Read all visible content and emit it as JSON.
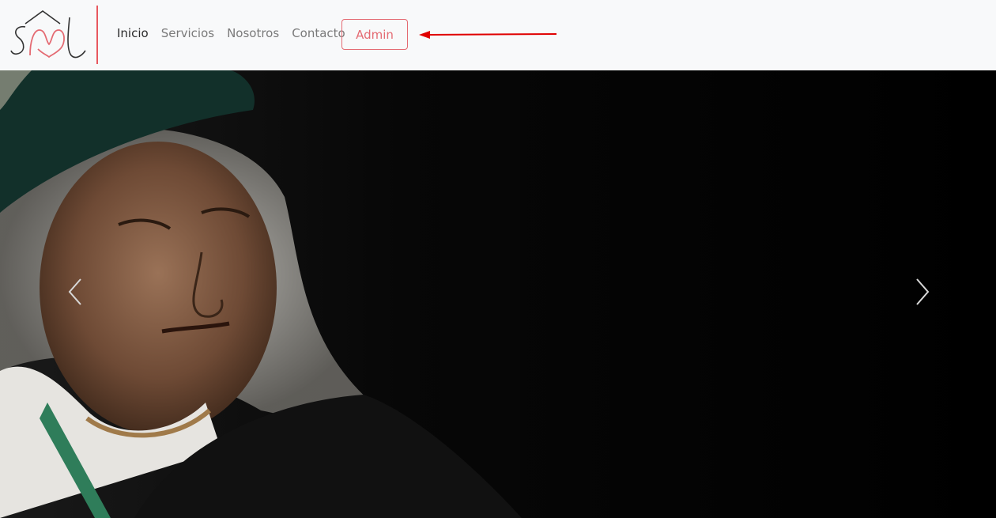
{
  "navbar": {
    "logo_alt": "SML",
    "links": [
      {
        "label": "Inicio",
        "active": true
      },
      {
        "label": "Servicios",
        "active": false
      },
      {
        "label": "Nosotros",
        "active": false
      },
      {
        "label": "Contacto",
        "active": false
      }
    ],
    "admin_label": "Admin"
  },
  "colors": {
    "brand_red": "#e46a72",
    "divider": "#e8585f",
    "nav_bg": "#f8f9fa",
    "annotation_arrow": "#e00000"
  },
  "icons": {
    "prev": "chevron-left-icon",
    "next": "chevron-right-icon",
    "logo": "house-logo-icon"
  }
}
